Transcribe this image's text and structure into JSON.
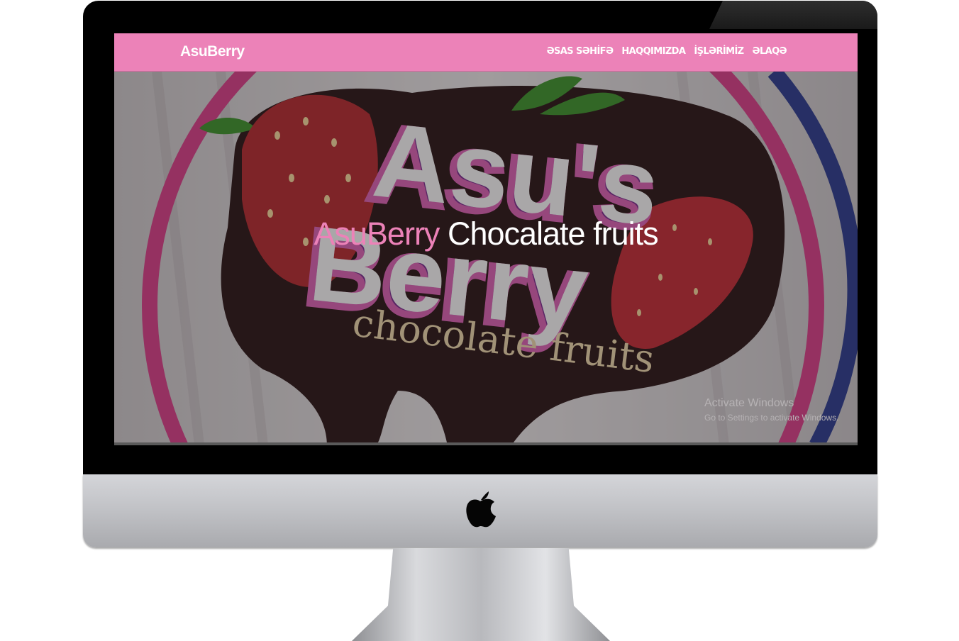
{
  "navbar": {
    "brand": "AsuBerry",
    "links": [
      "ƏSAS SƏHİFƏ",
      "HAQQIMIZDA",
      "İŞLƏRİMİZ",
      "ƏLAQƏ"
    ]
  },
  "hero": {
    "title_pink": "AsuBerry",
    "title_white": "Chocalate fruits",
    "logo_line1": "Asu's",
    "logo_line2": "Berry",
    "logo_tagline": "chocolate fruits"
  },
  "watermark": {
    "title": "Activate Windows",
    "subtitle": "Go to Settings to activate Windows."
  },
  "colors": {
    "navbar": "#ec82b8",
    "accent": "#ec82b8",
    "chocolate": "#2b1416",
    "ring_pink": "#d63d86",
    "ring_blue": "#2d3a8c"
  },
  "icons": {
    "apple_logo": "apple-logo-icon"
  }
}
